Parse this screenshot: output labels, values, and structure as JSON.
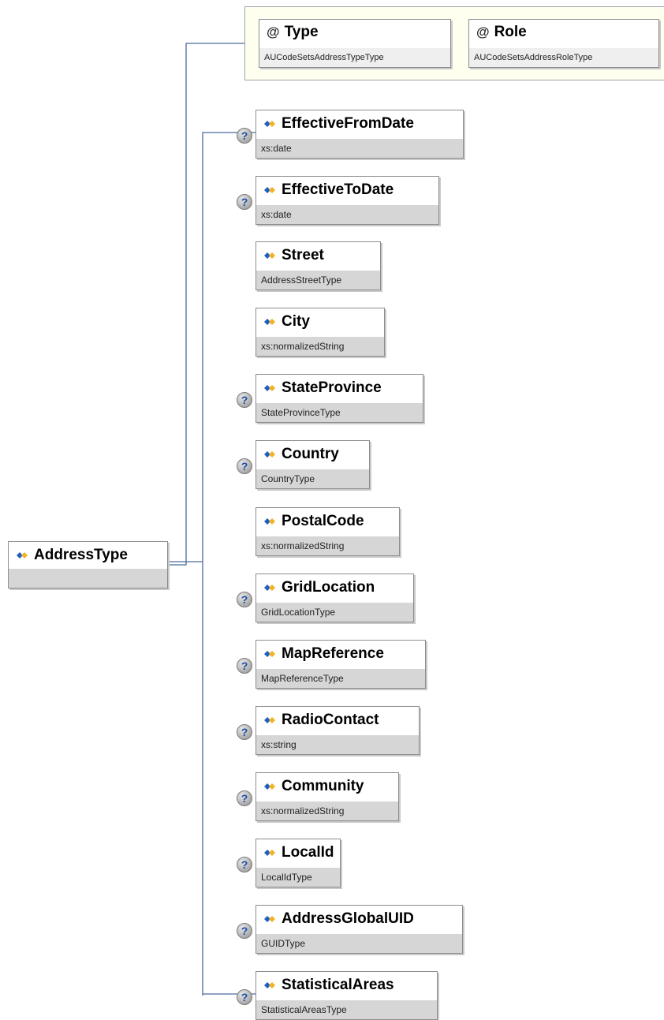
{
  "root": {
    "name": "AddressType"
  },
  "attributes": [
    {
      "name": "Type",
      "type": "AUCodeSetsAddressTypeType"
    },
    {
      "name": "Role",
      "type": "AUCodeSetsAddressRoleType"
    }
  ],
  "optional_marker": "?",
  "attribute_marker": "@",
  "elements": [
    {
      "name": "EffectiveFromDate",
      "type": "xs:date",
      "optional": true
    },
    {
      "name": "EffectiveToDate",
      "type": "xs:date",
      "optional": true
    },
    {
      "name": "Street",
      "type": "AddressStreetType",
      "optional": false
    },
    {
      "name": "City",
      "type": "xs:normalizedString",
      "optional": false
    },
    {
      "name": "StateProvince",
      "type": "StateProvinceType",
      "optional": true
    },
    {
      "name": "Country",
      "type": "CountryType",
      "optional": true
    },
    {
      "name": "PostalCode",
      "type": "xs:normalizedString",
      "optional": false
    },
    {
      "name": "GridLocation",
      "type": "GridLocationType",
      "optional": true
    },
    {
      "name": "MapReference",
      "type": "MapReferenceType",
      "optional": true
    },
    {
      "name": "RadioContact",
      "type": "xs:string",
      "optional": true
    },
    {
      "name": "Community",
      "type": "xs:normalizedString",
      "optional": true
    },
    {
      "name": "LocalId",
      "type": "LocalIdType",
      "optional": true
    },
    {
      "name": "AddressGlobalUID",
      "type": "GUIDType",
      "optional": true
    },
    {
      "name": "StatisticalAreas",
      "type": "StatisticalAreasType",
      "optional": true
    }
  ],
  "colors": {
    "connector": "#4a6b9c",
    "subtype_bg": "#d6d6d6",
    "attr_group_bg": "#fffff0"
  },
  "icons": {
    "element": "element-diamond-icon",
    "optional": "question-mark-icon",
    "attribute": "at-sign-icon"
  }
}
